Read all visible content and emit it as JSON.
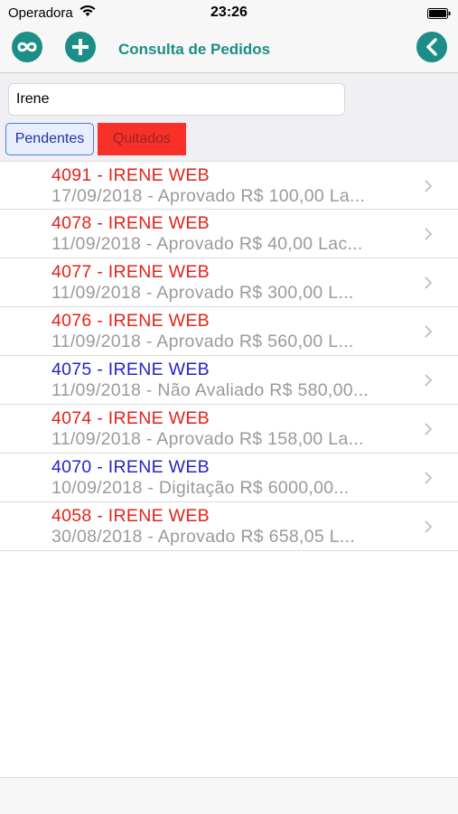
{
  "status_bar": {
    "carrier": "Operadora",
    "time": "23:26"
  },
  "nav": {
    "title": "Consulta de Pedidos"
  },
  "search": {
    "value": "Irene"
  },
  "tabs": {
    "pendentes": "Pendentes",
    "quitados": "Quitados"
  },
  "colors": {
    "accent": "#1b8e86",
    "red_status": "#e2231a",
    "blue_status": "#2424c8",
    "quitados_bg": "#f7312a"
  },
  "orders": [
    {
      "title": "4091 - IRENE WEB",
      "subtitle": "17/09/2018 - Aprovado R$ 100,00 La...",
      "color": "red"
    },
    {
      "title": "4078 - IRENE WEB",
      "subtitle": "11/09/2018 - Aprovado R$ 40,00 Lac...",
      "color": "red"
    },
    {
      "title": "4077 - IRENE WEB",
      "subtitle": "11/09/2018 - Aprovado R$ 300,00 L...",
      "color": "red"
    },
    {
      "title": "4076 - IRENE WEB",
      "subtitle": "11/09/2018 - Aprovado R$ 560,00 L...",
      "color": "red"
    },
    {
      "title": "4075 - IRENE WEB",
      "subtitle": "11/09/2018 - Não Avaliado R$ 580,00...",
      "color": "blue"
    },
    {
      "title": "4074 - IRENE WEB",
      "subtitle": "11/09/2018 - Aprovado R$ 158,00 La...",
      "color": "red"
    },
    {
      "title": "4070 - IRENE WEB",
      "subtitle": "10/09/2018 - Digitação R$ 6000,00...",
      "color": "blue"
    },
    {
      "title": "4058 - IRENE WEB",
      "subtitle": "30/08/2018 - Aprovado R$ 658,05 L...",
      "color": "red"
    }
  ]
}
